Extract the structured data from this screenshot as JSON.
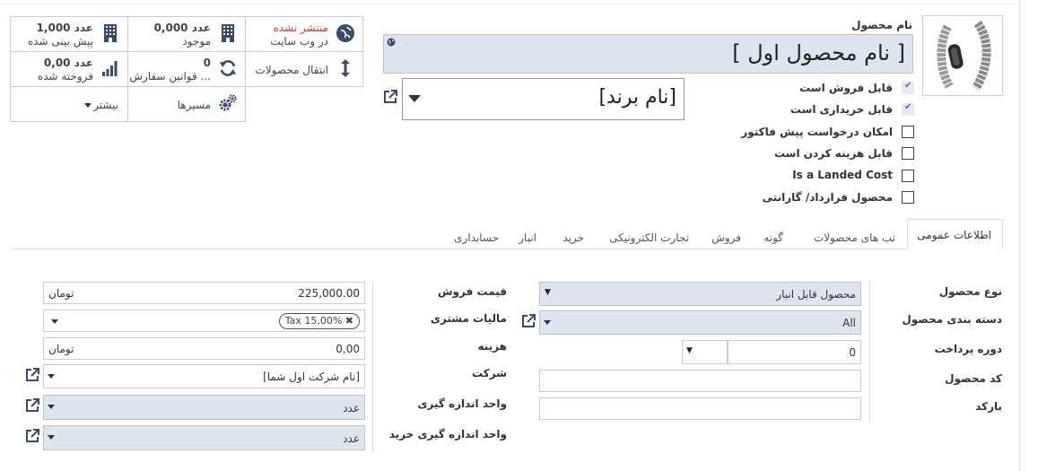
{
  "smart_buttons": {
    "website": {
      "line1": "منتشر نشده",
      "line2": "در وب سایت"
    },
    "on_hand": {
      "line1": "0,000 عدد",
      "line2": "موجود"
    },
    "forecast": {
      "line1": "1,000 عدد",
      "line2": "پیش بینی شده"
    },
    "moves": {
      "line1": "انتقال محصولات"
    },
    "reorder": {
      "line1": "0",
      "line2": "قوانین سفارش ..."
    },
    "sold": {
      "line1": "0,00 عدد",
      "line2": "فروخته شده"
    },
    "routes": {
      "line1": "مسیرها"
    },
    "more": {
      "line1": "بیشتر"
    }
  },
  "product": {
    "name_label": "نام محصول",
    "name_value": "[ نام محصول اول ]",
    "brand_value": "[نام برند]"
  },
  "checkboxes": [
    {
      "label": "قابل فروش است",
      "checked": true
    },
    {
      "label": "قابل خریداری است",
      "checked": true
    },
    {
      "label": "امکان درخواست پیش فاکتور",
      "checked": false
    },
    {
      "label": "قابل هزینه کردن است",
      "checked": false
    },
    {
      "label": "Is a Landed Cost",
      "checked": false
    },
    {
      "label": "محصول قرارداد/ گارانتی",
      "checked": false
    }
  ],
  "tabs": [
    "اطلاعات عمومی",
    "تب های محصولات",
    "گونه",
    "فروش",
    "تجارت الکترونیکی",
    "خرید",
    "انبار",
    "حسابداری"
  ],
  "right_form": {
    "product_type": {
      "label": "نوع محصول",
      "value": "محصول قابل انبار"
    },
    "category": {
      "label": "دسته بندی محصول",
      "value": "All"
    },
    "payment_term": {
      "label": "دوره پرداخت",
      "value": "0"
    },
    "code": {
      "label": "کد محصول",
      "value": ""
    },
    "barcode": {
      "label": "بارکد",
      "value": ""
    }
  },
  "left_form": {
    "sale_price": {
      "label": "قیمت فروش",
      "value": "225,000.00",
      "currency": "تومان"
    },
    "customer_tax": {
      "label": "مالیات مشتری",
      "tag": "Tax 15,00%"
    },
    "cost": {
      "label": "هزینه",
      "value": "0,00",
      "currency": "تومان"
    },
    "company": {
      "label": "شرکت",
      "value": "[نام شرکت اول شما]"
    },
    "uom": {
      "label": "واحد اندازه گیری",
      "value": "عدد"
    },
    "purchase_uom": {
      "label": "واحد اندازه گیری خرید",
      "value": "عدد"
    }
  }
}
